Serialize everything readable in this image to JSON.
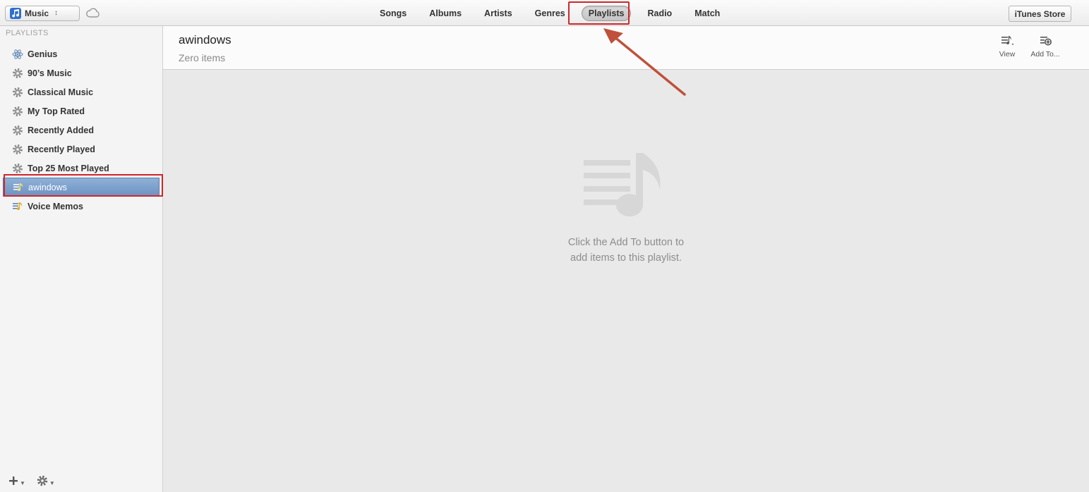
{
  "toolbar": {
    "media_picker_label": "Music",
    "nav_items": [
      "Songs",
      "Albums",
      "Artists",
      "Genres",
      "Playlists",
      "Radio",
      "Match"
    ],
    "active_nav": "Playlists",
    "store_button": "iTunes Store"
  },
  "sidebar": {
    "heading": "PLAYLISTS",
    "items": [
      {
        "label": "Genius",
        "icon": "genius-icon"
      },
      {
        "label": "90’s Music",
        "icon": "smart-playlist-gear-icon"
      },
      {
        "label": "Classical Music",
        "icon": "smart-playlist-gear-icon"
      },
      {
        "label": "My Top Rated",
        "icon": "smart-playlist-gear-icon"
      },
      {
        "label": "Recently Added",
        "icon": "smart-playlist-gear-icon"
      },
      {
        "label": "Recently Played",
        "icon": "smart-playlist-gear-icon"
      },
      {
        "label": "Top 25 Most Played",
        "icon": "smart-playlist-gear-icon"
      },
      {
        "label": "awindows",
        "icon": "playlist-icon",
        "selected": true
      },
      {
        "label": "Voice Memos",
        "icon": "playlist-icon"
      }
    ]
  },
  "content": {
    "title": "awindows",
    "subtitle": "Zero items",
    "view_label": "View",
    "add_to_label": "Add To...",
    "empty_line1": "Click the Add To button to",
    "empty_line2": "add items to this playlist."
  },
  "colors": {
    "highlight": "#d0262a",
    "arrow": "#c0503a",
    "selected_row": "#7a9cc9",
    "accent_blue": "#2f6fd0"
  }
}
